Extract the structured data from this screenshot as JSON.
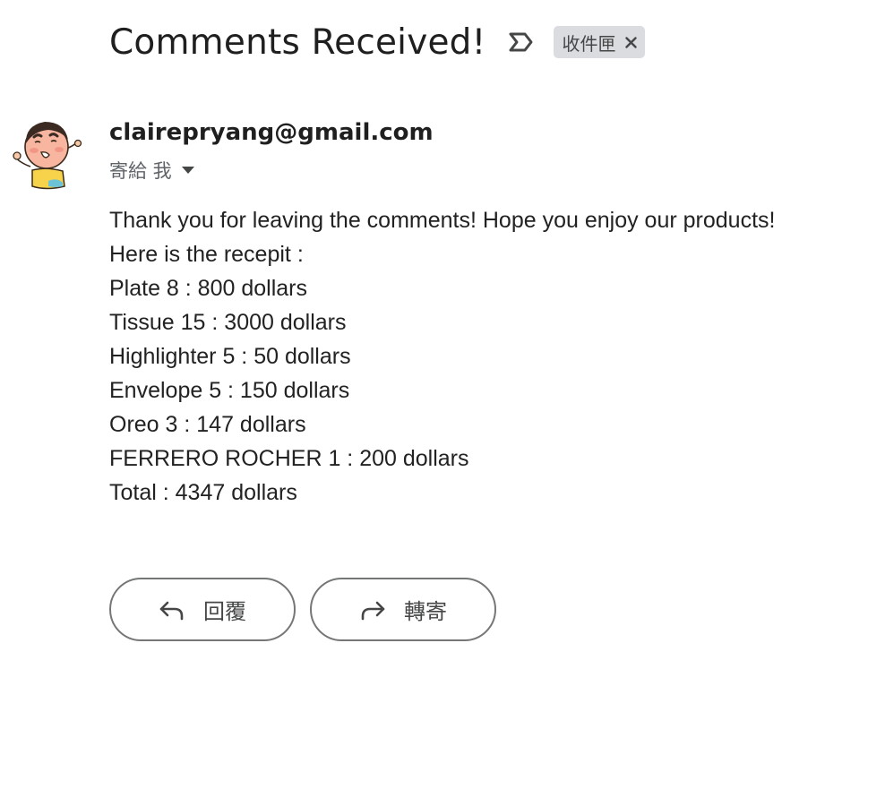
{
  "email": {
    "subject": "Comments Received!",
    "label_chip": "收件匣",
    "sender": "clairepryang@gmail.com",
    "recipient": "寄給 我",
    "body_lines": [
      "Thank you for leaving the comments! Hope you enjoy our products!",
      "Here is the recepit :",
      "Plate 8 : 800 dollars",
      "Tissue 15 : 3000 dollars",
      "Highlighter 5 : 50 dollars",
      "Envelope 5 : 150 dollars",
      "Oreo 3 : 147 dollars",
      "FERRERO ROCHER 1 : 200 dollars",
      "Total : 4347 dollars"
    ]
  },
  "actions": {
    "reply_label": "回覆",
    "forward_label": "轉寄"
  },
  "icons": {
    "importance": "importance-marker-icon",
    "chip_close": "close-icon",
    "recipient_caret": "caret-down-icon",
    "reply": "reply-arrow-icon",
    "forward": "forward-arrow-icon",
    "avatar": "cartoon-avatar"
  },
  "colors": {
    "chip_bg": "#dadce0",
    "button_border": "#747775",
    "text_primary": "#1f1f1f",
    "text_secondary": "#5f6368"
  }
}
